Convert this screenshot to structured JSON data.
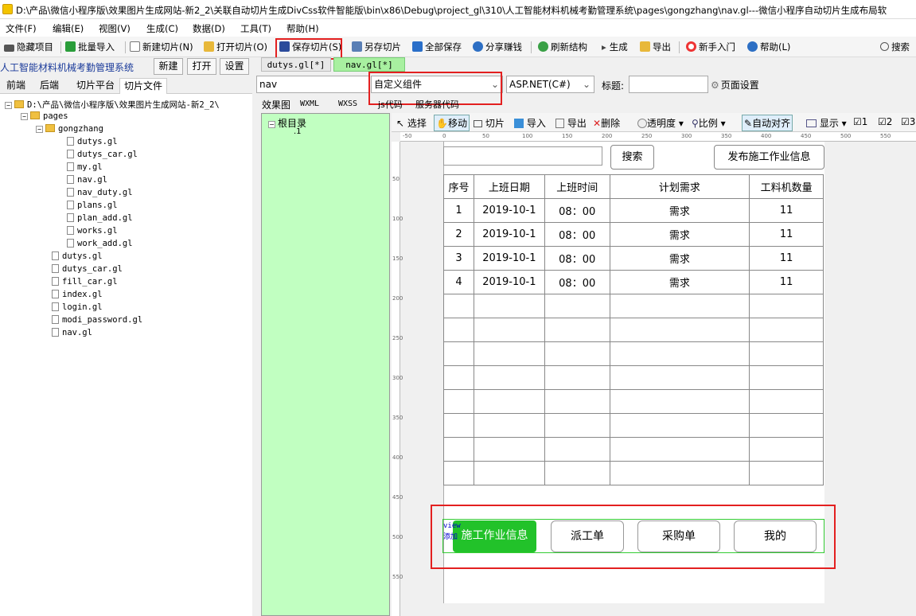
{
  "title_bar": {
    "title": "D:\\产品\\微信小程序版\\效果图片生成网站-新2_2\\关联自动切片生成DivCss软件智能版\\bin\\x86\\Debug\\project_gl\\310\\人工智能材料机械考勤管理系统\\pages\\gongzhang\\nav.gl---微信小程序自动切片生成布局软"
  },
  "menu": [
    "文件(F)",
    "编辑(E)",
    "视图(V)",
    "生成(C)",
    "数据(D)",
    "工具(T)",
    "帮助(H)"
  ],
  "toolbar": {
    "hide": "隐藏项目",
    "batch_import": "批量导入",
    "new_slice": "新建切片(N)",
    "open_slice": "打开切片(O)",
    "save_slice": "保存切片(S)",
    "save_as": "另存切片",
    "save_all": "全部保存",
    "share": "分享赚钱",
    "refresh": "刷新结构",
    "generate": "生成",
    "export": "导出",
    "guide": "新手入门",
    "help": "帮助(L)",
    "search": "搜索"
  },
  "project": {
    "name": "人工智能材料机械考勤管理系统",
    "new": "新建",
    "open": "打开",
    "settings": "设置"
  },
  "left_tabs": [
    "前端",
    "后端",
    "切片平台",
    "切片文件"
  ],
  "tree": {
    "root": "D:\\产品\\微信小程序版\\效果图片生成网站-新2_2\\",
    "pages": "pages",
    "gongzhang": "gongzhang",
    "gz_files": [
      "dutys.gl",
      "dutys_car.gl",
      "my.gl",
      "nav.gl",
      "nav_duty.gl",
      "plans.gl",
      "plan_add.gl",
      "works.gl",
      "work_add.gl"
    ],
    "files": [
      "dutys.gl",
      "dutys_car.gl",
      "fill_car.gl",
      "index.gl",
      "login.gl",
      "modi_password.gl",
      "nav.gl"
    ]
  },
  "doc_tabs": [
    "dutys.gl[*]",
    "nav.gl[*]"
  ],
  "controls": {
    "name": "nav",
    "component": "自定义组件",
    "lang": "ASP.NET(C#)",
    "title_label": "标题:",
    "title_value": "",
    "page_settings": "页面设置"
  },
  "sub_tabs": [
    "效果图",
    "WXML",
    "WXSS",
    "js代码",
    "服务器代码"
  ],
  "outline": {
    "root": "根目录",
    "child": ".1"
  },
  "design_toolbar": {
    "select": "选择",
    "move": "移动",
    "slice": "切片",
    "import": "导入",
    "export": "导出",
    "delete": "删除",
    "opacity": "透明度",
    "ratio": "比例",
    "align": "自动对齐",
    "show": "显示",
    "c1": "1",
    "c2": "2",
    "c3": "3"
  },
  "ruler_h": [
    "-50",
    "0",
    "50",
    "100",
    "150",
    "200",
    "250",
    "300",
    "350",
    "400",
    "450",
    "500",
    "550"
  ],
  "ruler_v": [
    "50",
    "100",
    "150",
    "200",
    "250",
    "300",
    "350",
    "400",
    "450",
    "500",
    "550"
  ],
  "canvas": {
    "search_btn": "搜索",
    "publish_btn": "发布施工作业信息",
    "table_headers": [
      "序号",
      "上班日期",
      "上班时间",
      "计划需求",
      "工料机数量"
    ],
    "rows": [
      [
        "1",
        "2019-10-1",
        "08：00",
        "需求",
        "11"
      ],
      [
        "2",
        "2019-10-1",
        "08：00",
        "需求",
        "11"
      ],
      [
        "3",
        "2019-10-1",
        "08：00",
        "需求",
        "11"
      ],
      [
        "4",
        "2019-10-1",
        "08：00",
        "需求",
        "11"
      ]
    ],
    "nav_label": "view",
    "nav_sub": "添加",
    "nav_items": [
      "施工作业信息",
      "派工单",
      "采购单",
      "我的"
    ]
  }
}
